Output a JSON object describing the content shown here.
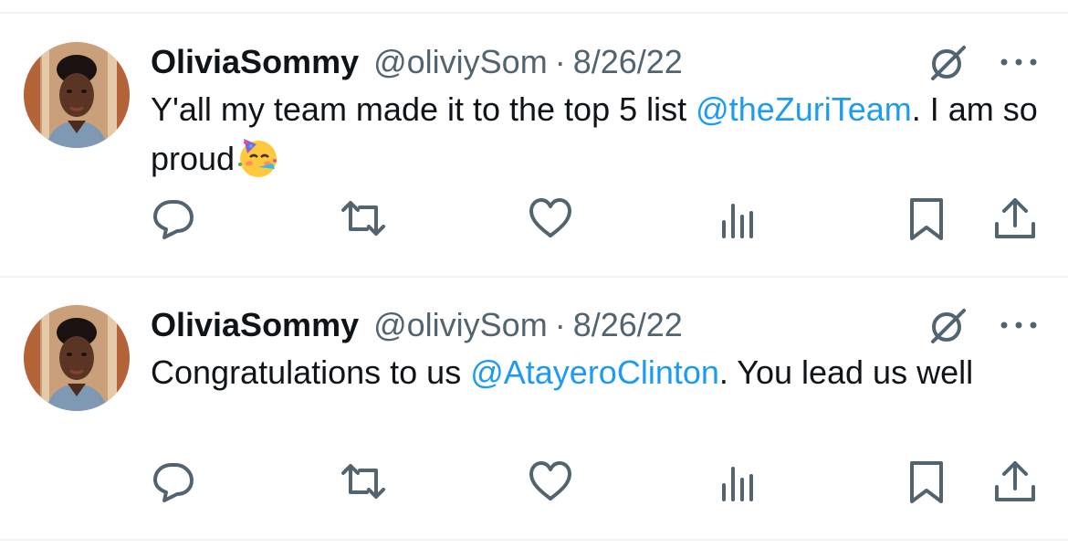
{
  "tweets": [
    {
      "author_name": "OliviaSommy",
      "handle": "@oliviySom",
      "separator": "·",
      "date": "8/26/22",
      "text_before": "Y'all my team made it to the top 5 list ",
      "mention": "@theZuriTeam",
      "text_after": ". I am so proud",
      "emoji": "partying-face"
    },
    {
      "author_name": "OliviaSommy",
      "handle": "@oliviySom",
      "separator": "·",
      "date": "8/26/22",
      "text_before": "Congratulations to us ",
      "mention": "@AtayeroClinton",
      "text_after": ". You lead us well"
    }
  ],
  "colors": {
    "text": "#0f1419",
    "secondary": "#536471",
    "link": "#1d9bf0",
    "divider": "#eff3f4"
  },
  "icons": [
    "grok-icon",
    "more-icon",
    "reply-icon",
    "retweet-icon",
    "like-icon",
    "views-icon",
    "bookmark-icon",
    "share-icon"
  ]
}
